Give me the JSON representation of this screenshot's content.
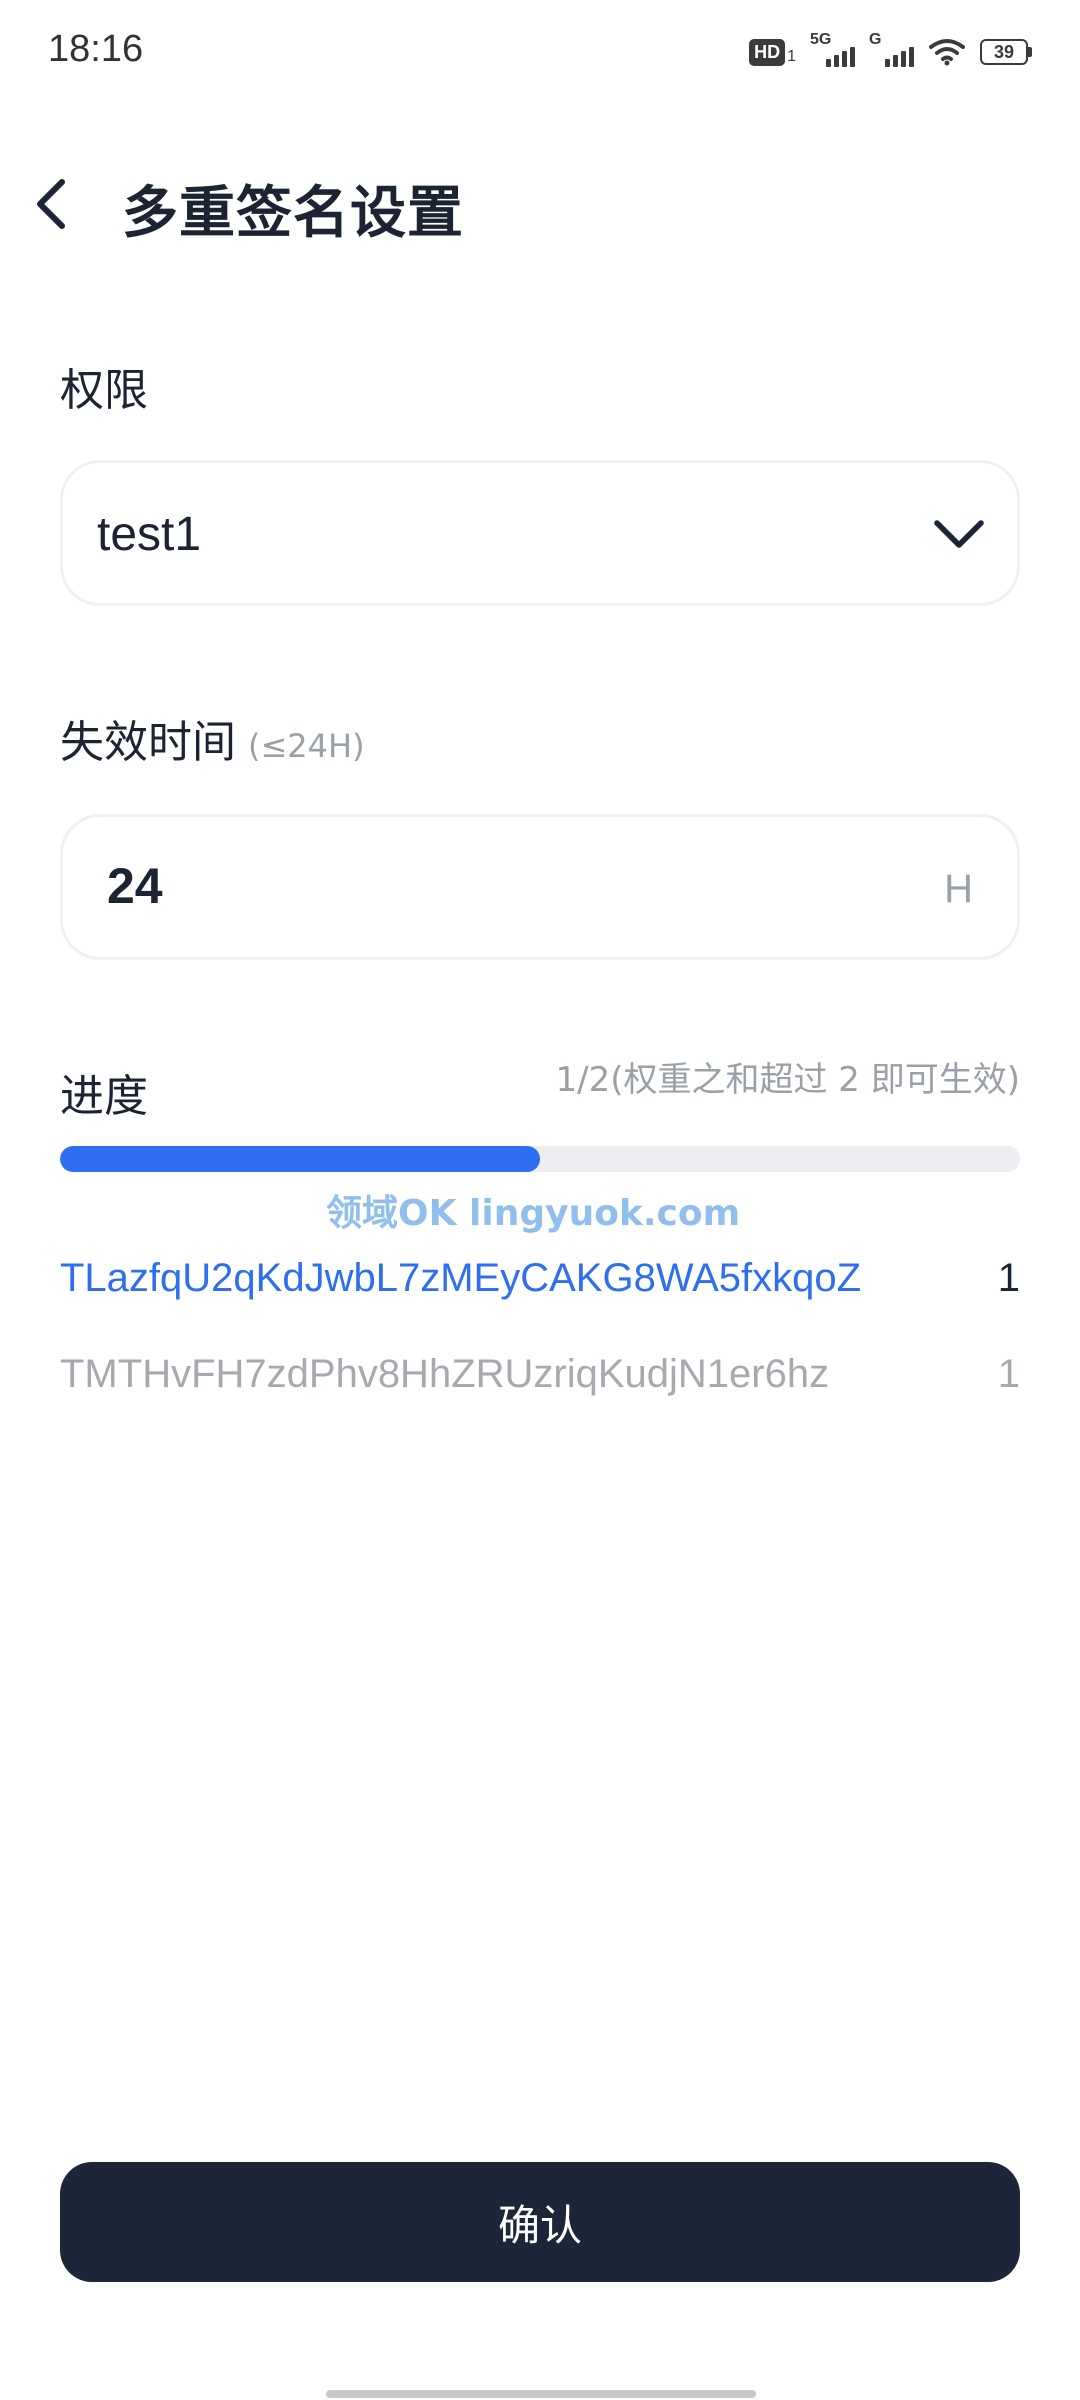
{
  "status_bar": {
    "time": "18:16",
    "hd_label": "HD",
    "hd_sub": "1",
    "sim1_label": "5G",
    "sim2_label": "G",
    "battery_level": "39"
  },
  "header": {
    "title": "多重签名设置"
  },
  "permission": {
    "label": "权限",
    "selected": "test1"
  },
  "expiry": {
    "label": "失效时间",
    "hint": "(≤24H)",
    "value": "24",
    "unit": "H"
  },
  "progress": {
    "label": "进度",
    "status": "1/2(权重之和超过 2 即可生效)",
    "fraction": 0.5,
    "color": "#2d6ff0"
  },
  "watermark": "领域OK lingyuok.com",
  "signers": [
    {
      "address": "TLazfqU2qKdJwbL7zMEyCAKG8WA5fxkqoZ",
      "weight": "1",
      "signed": true
    },
    {
      "address": "TMTHvFH7zdPhv8HhZRUzriqKudjN1er6hz",
      "weight": "1",
      "signed": false
    }
  ],
  "confirm_button": {
    "label": "确认"
  }
}
